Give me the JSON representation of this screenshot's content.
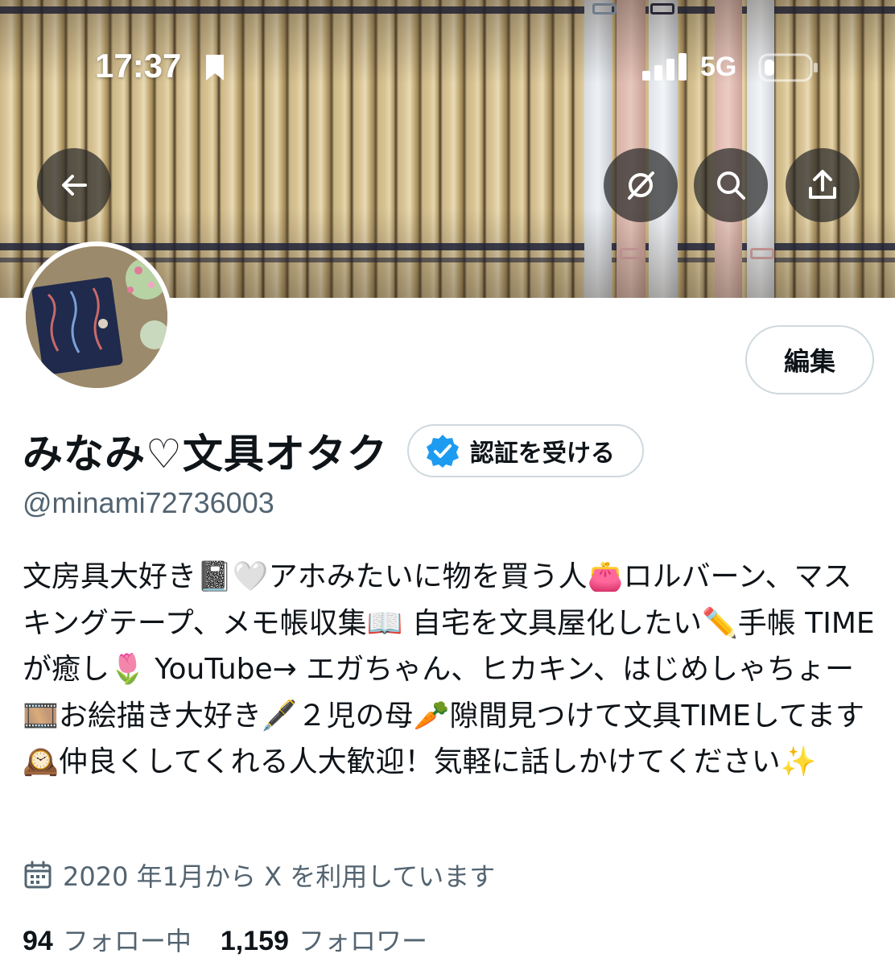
{
  "status_bar": {
    "time": "17:37",
    "network": "5G",
    "icons": [
      "bookmark-icon",
      "signal-icon",
      "battery-icon"
    ]
  },
  "header_actions": {
    "icons": [
      "back-arrow-icon",
      "grok-icon",
      "search-icon",
      "share-icon"
    ]
  },
  "profile": {
    "edit_label": "編集",
    "display_name": "みなみ♡文具オタク",
    "verify_label": "認証を受ける",
    "handle": "@minami72736003",
    "bio": "文房具大好き📓🤍アホみたいに物を買う人👛ロルバーン、マスキングテープ、メモ帳収集📖 自宅を文具屋化したい✏️手帳 TIMEが癒し🌷 YouTube→ エガちゃん、ヒカキン、はじめしゃちょー🎞️お絵描き大好き🖋️２児の母🥕隙間見つけて文具TIMEしてます🕰️仲良くしてくれる人大歓迎！気軽に話しかけてください✨",
    "joined": "2020 年1月から X を利用しています",
    "following_count": "94",
    "following_label": "フォロー中",
    "followers_count": "1,159",
    "followers_label": "フォロワー"
  },
  "colors": {
    "text_primary": "#0f1419",
    "text_secondary": "#536471",
    "verified_blue": "#1d9bf0",
    "border": "#cfd9de"
  }
}
